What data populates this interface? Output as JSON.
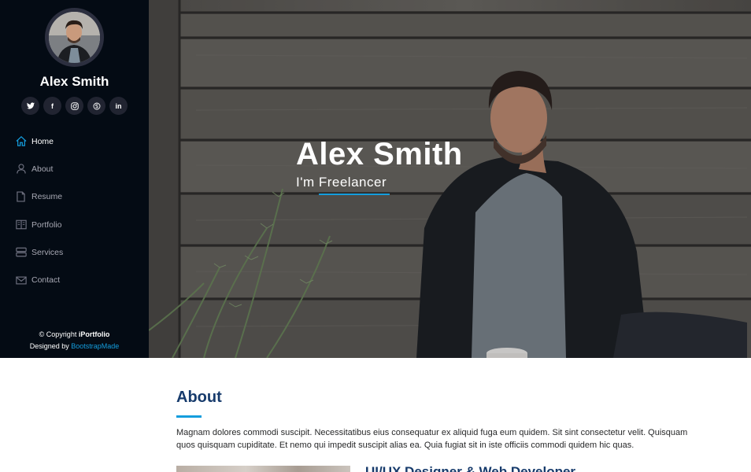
{
  "sidebar": {
    "profile_name": "Alex Smith",
    "social": [
      {
        "icon": "twitter-icon",
        "glyph": ""
      },
      {
        "icon": "facebook-icon",
        "glyph": "f"
      },
      {
        "icon": "instagram-icon",
        "glyph": ""
      },
      {
        "icon": "skype-icon",
        "glyph": ""
      },
      {
        "icon": "linkedin-icon",
        "glyph": "in"
      }
    ],
    "nav": [
      {
        "label": "Home",
        "icon": "home-icon",
        "active": true
      },
      {
        "label": "About",
        "icon": "person-icon",
        "active": false
      },
      {
        "label": "Resume",
        "icon": "file-icon",
        "active": false
      },
      {
        "label": "Portfolio",
        "icon": "book-icon",
        "active": false
      },
      {
        "label": "Services",
        "icon": "server-icon",
        "active": false
      },
      {
        "label": "Contact",
        "icon": "envelope-icon",
        "active": false
      }
    ],
    "footer": {
      "copyright_prefix": "© Copyright ",
      "brand": "iPortfolio",
      "designed_prefix": "Designed by ",
      "designer": "BootstrapMade"
    }
  },
  "hero": {
    "title": "Alex Smith",
    "subtitle": "I'm Freelancer"
  },
  "about": {
    "title": "About",
    "paragraph": "Magnam dolores commodi suscipit. Necessitatibus eius consequatur ex aliquid fuga eum quidem. Sit sint consectetur velit. Quisquam quos quisquam cupiditate. Et nemo qui impedit suscipit alias ea. Quia fugiat sit in iste officiis commodi quidem hic quas.",
    "subheading": "UI/UX Designer & Web Developer"
  },
  "colors": {
    "sidebar_bg": "#040b14",
    "accent": "#149ddd",
    "heading": "#173b6c"
  }
}
